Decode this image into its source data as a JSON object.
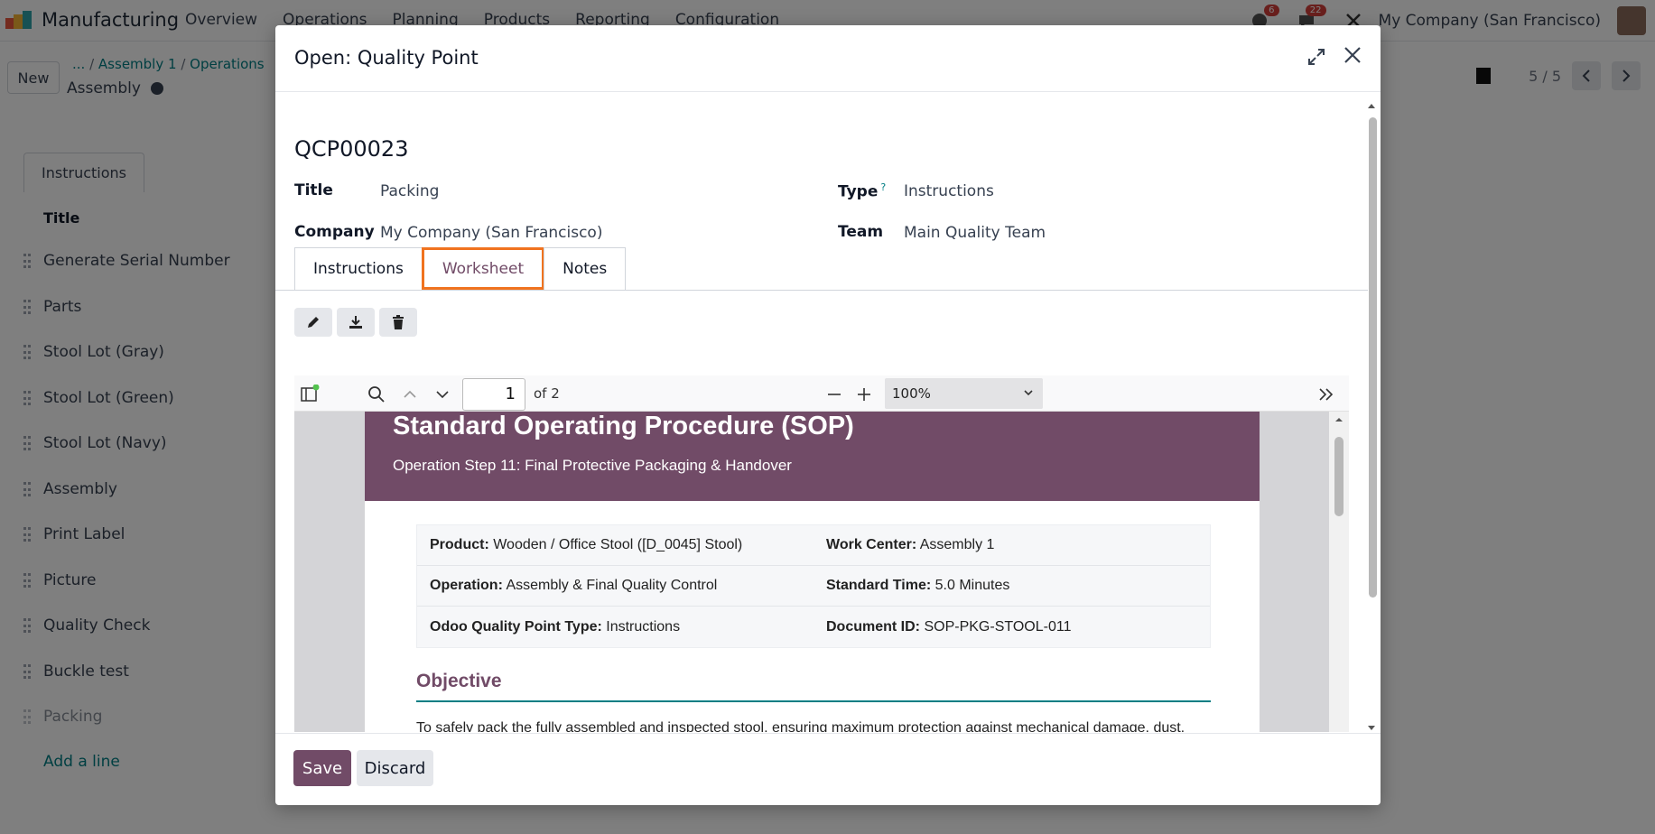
{
  "app": {
    "name": "Manufacturing",
    "menu": [
      "Overview",
      "Operations",
      "Planning",
      "Products",
      "Reporting",
      "Configuration"
    ],
    "activity_count": "6",
    "messages_count": "22",
    "company": "My Company (San Francisco)"
  },
  "control": {
    "new_label": "New",
    "breadcrumb": [
      "...",
      "Assembly 1",
      "Operations"
    ],
    "current": "Assembly",
    "pager": "5 / 5"
  },
  "background_list": {
    "tab": "Instructions",
    "header": "Title",
    "rows": [
      "Generate Serial Number",
      "Parts",
      "Stool Lot (Gray)",
      "Stool Lot (Green)",
      "Stool Lot (Navy)",
      "Assembly",
      "Print Label",
      "Picture",
      "Quality Check",
      "Buckle test",
      "Packing"
    ],
    "add_line": "Add a line"
  },
  "modal": {
    "title": "Open: Quality Point",
    "record_name": "QCP00023",
    "fields": {
      "title_label": "Title",
      "title_value": "Packing",
      "company_label": "Company",
      "company_value": "My Company (San Francisco)",
      "type_label": "Type",
      "type_help": "?",
      "type_value": "Instructions",
      "team_label": "Team",
      "team_value": "Main Quality Team"
    },
    "tabs": [
      "Instructions",
      "Worksheet",
      "Notes"
    ],
    "active_tab": "Worksheet",
    "pdf": {
      "page_number": "1",
      "page_of": "of 2",
      "zoom": "100%",
      "sop_title": "Standard Operating Procedure (SOP)",
      "sop_subtitle": "Operation Step 11: Final Protective Packaging & Handover",
      "info": [
        {
          "k1": "Product:",
          "v1": "Wooden / Office Stool ([D_0045] Stool)",
          "k2": "Work Center:",
          "v2": "Assembly 1"
        },
        {
          "k1": "Operation:",
          "v1": "Assembly & Final Quality Control",
          "k2": "Standard Time:",
          "v2": "5.0 Minutes"
        },
        {
          "k1": "Odoo Quality Point Type:",
          "v1": "Instructions",
          "k2": "Document ID:",
          "v2": "SOP-PKG-STOOL-011"
        }
      ],
      "objective_heading": "Objective",
      "objective_text": "To safely pack the fully assembled and inspected stool, ensuring maximum protection against mechanical damage, dust, and moisture during storage and transit to the warehouse."
    },
    "save_label": "Save",
    "discard_label": "Discard"
  },
  "colors": {
    "brand": "#714b67",
    "accent_teal": "#017e84",
    "highlight": "#f0731f"
  }
}
